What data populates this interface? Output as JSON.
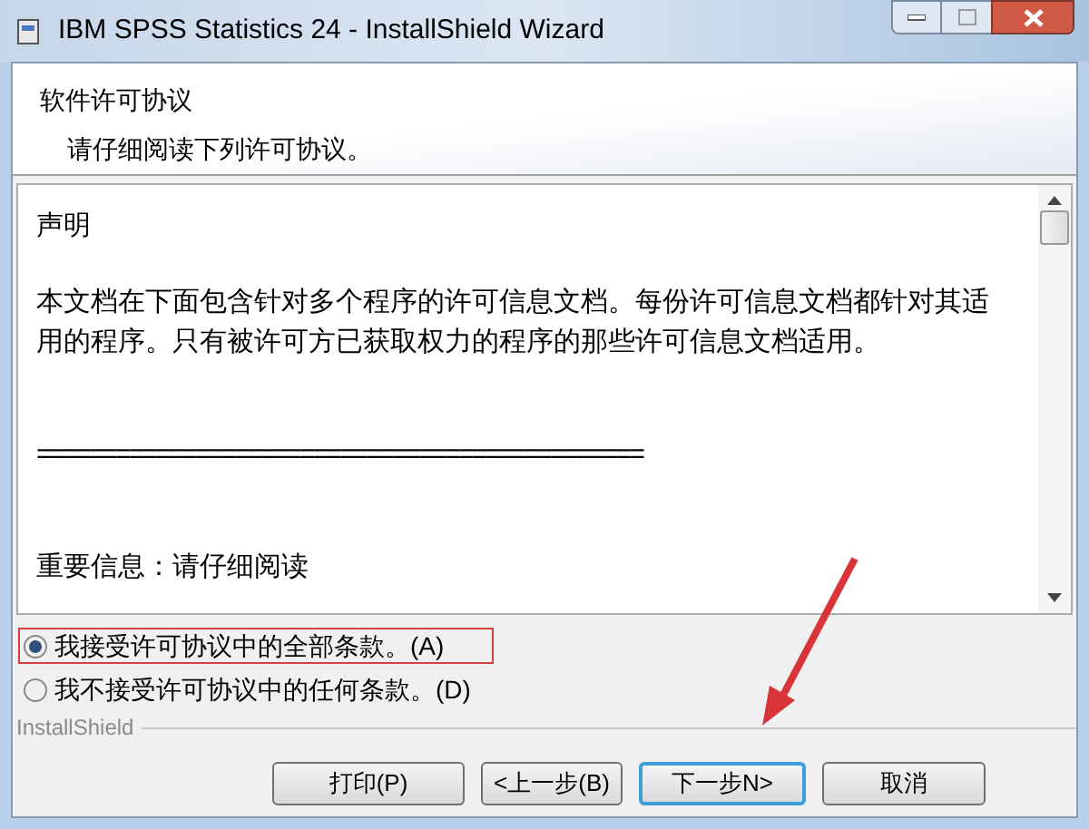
{
  "window": {
    "title": "IBM SPSS Statistics 24 - InstallShield Wizard"
  },
  "header": {
    "title": "软件许可协议",
    "subtitle": "请仔细阅读下列许可协议。"
  },
  "license_text": [
    "声明",
    "本文档在下面包含针对多个程序的许可信息文档。每份许可信息文档都针对其适用的程序。只有被许可方已获取权力的程序的那些许可信息文档适用。",
    "==============================================",
    "重要信息：请仔细阅读"
  ],
  "options": [
    {
      "label": "我接受许可协议中的全部条款。(A)",
      "selected": true,
      "highlighted": true
    },
    {
      "label": "我不接受许可协议中的任何条款。(D)",
      "selected": false,
      "highlighted": false
    }
  ],
  "brand": "InstallShield",
  "buttons": [
    {
      "label": "打印(P)",
      "default": false
    },
    {
      "label": "<上一步(B)",
      "default": false
    },
    {
      "label": "下一步N>",
      "default": true
    },
    {
      "label": "取消",
      "default": false
    }
  ],
  "annotation": {
    "kind": "arrow"
  }
}
